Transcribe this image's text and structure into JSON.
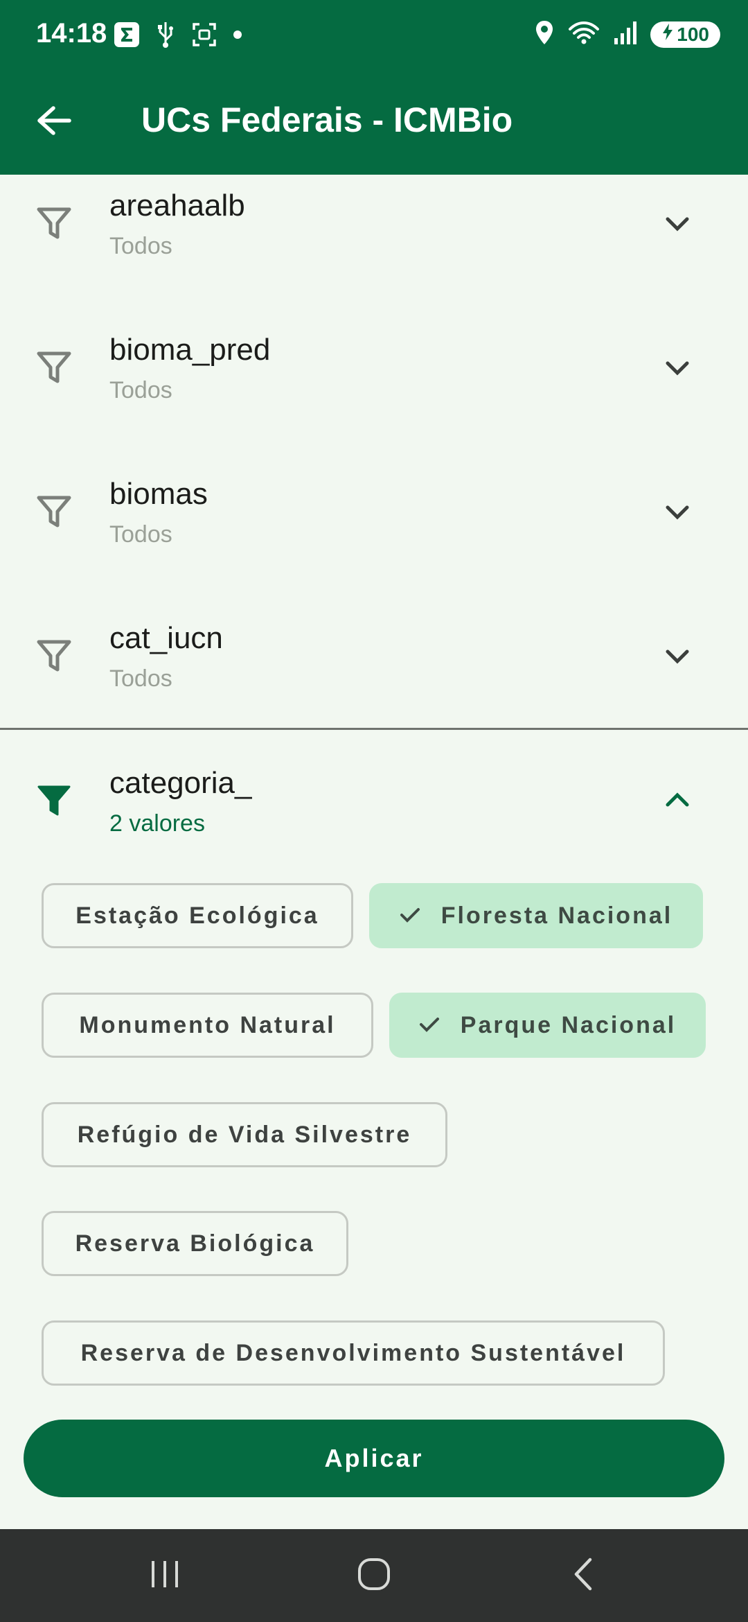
{
  "status_bar": {
    "time": "14:18",
    "battery": "100",
    "left_icons": [
      "sigma-app-icon",
      "usb-icon",
      "screenshot-icon",
      "dot-icon"
    ],
    "right_icons": [
      "location-icon",
      "wifi-icon",
      "signal-icon",
      "battery-charging-icon"
    ]
  },
  "app_bar": {
    "title": "UCs Federais - ICMBio",
    "back_icon": "arrow-left-icon"
  },
  "filters": [
    {
      "name": "areahaalb",
      "value": "Todos"
    },
    {
      "name": "bioma_pred",
      "value": "Todos"
    },
    {
      "name": "biomas",
      "value": "Todos"
    },
    {
      "name": "cat_iucn",
      "value": "Todos"
    },
    {
      "name": "categoria_",
      "value": "2 valores",
      "expanded": true
    }
  ],
  "chips": [
    {
      "label": "Estação Ecológica",
      "selected": false
    },
    {
      "label": "Floresta Nacional",
      "selected": true
    },
    {
      "label": "Monumento Natural",
      "selected": false
    },
    {
      "label": "Parque Nacional",
      "selected": true
    },
    {
      "label": "Refúgio de Vida Silvestre",
      "selected": false
    },
    {
      "label": "Reserva Biológica",
      "selected": false
    },
    {
      "label": "Reserva de Desenvolvimento Sustentável",
      "selected": false
    }
  ],
  "apply_button": "Aplicar",
  "nav_bar": [
    "recents-icon",
    "home-icon",
    "back-icon"
  ],
  "colors": {
    "primary": "#056b41",
    "background": "#f2f8f1",
    "chip_selected": "#c1ebcf",
    "nav_bar": "#2f3130"
  }
}
